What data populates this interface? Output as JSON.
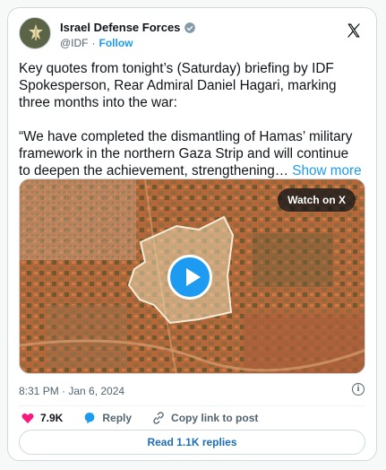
{
  "author": {
    "name": "Israel Defense Forces",
    "handle": "@IDF",
    "separator": "·",
    "follow_label": "Follow"
  },
  "tweet": {
    "text": "Key quotes from tonight’s (Saturday) briefing by IDF Spokesperson, Rear Admiral Daniel Hagari, marking three months into the war:\n\n“We have completed the dismantling of Hamas’ military framework in the northern Gaza Strip and will continue to deepen the achievement, strengthening…",
    "show_more_label": "Show more",
    "timestamp": "8:31 PM · Jan 6, 2024"
  },
  "media": {
    "watch_label": "Watch on X",
    "play_icon": "play-icon"
  },
  "actions": {
    "likes_count": "7.9K",
    "reply_label": "Reply",
    "copy_link_label": "Copy link to post",
    "read_replies_label": "Read 1.1K replies"
  },
  "colors": {
    "accent": "#1d9bf0",
    "like": "#f91880",
    "text": "#0f1419",
    "muted": "#536471"
  }
}
